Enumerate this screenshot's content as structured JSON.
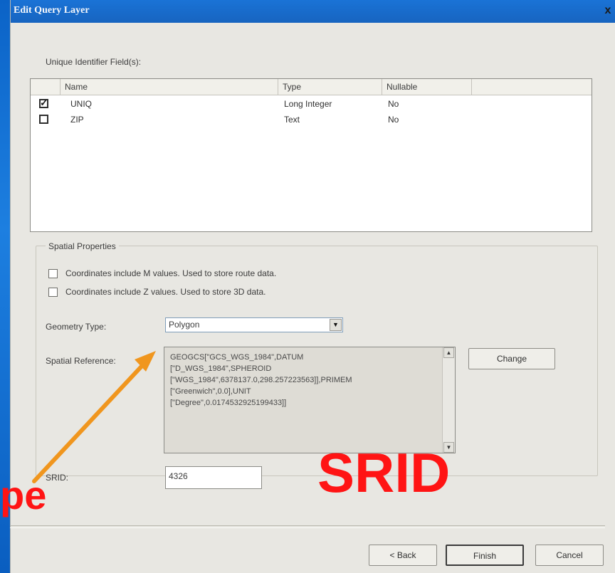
{
  "window": {
    "title": "Edit Query Layer",
    "close": "x"
  },
  "unique_fields": {
    "label": "Unique Identifier Field(s):",
    "columns": [
      "Name",
      "Type",
      "Nullable"
    ],
    "rows": [
      {
        "checked": true,
        "name": "UNIQ",
        "type": "Long Integer",
        "nullable": "No"
      },
      {
        "checked": false,
        "name": "ZIP",
        "type": "Text",
        "nullable": "No"
      }
    ]
  },
  "spatial": {
    "group_title": "Spatial Properties",
    "m_values": {
      "checked": false,
      "label": "Coordinates include M values. Used to store route data."
    },
    "z_values": {
      "checked": false,
      "label": "Coordinates include Z values. Used to store 3D data."
    },
    "geometry_type_label": "Geometry Type:",
    "geometry_type_value": "Polygon",
    "spatial_reference_label": "Spatial Reference:",
    "spatial_reference_text": "GEOGCS[\"GCS_WGS_1984\",DATUM\n[\"D_WGS_1984\",SPHEROID\n[\"WGS_1984\",6378137.0,298.257223563]],PRIMEM\n[\"Greenwich\",0.0],UNIT\n[\"Degree\",0.0174532925199433]]",
    "change_button": "Change",
    "srid_label": "SRID:",
    "srid_value": "4326"
  },
  "footer": {
    "back": "< Back",
    "finish": "Finish",
    "cancel": "Cancel"
  },
  "annotations": {
    "left": "pe",
    "right": "SRID",
    "arrow_color": "#f0961e",
    "text_color": "#ff1414"
  }
}
